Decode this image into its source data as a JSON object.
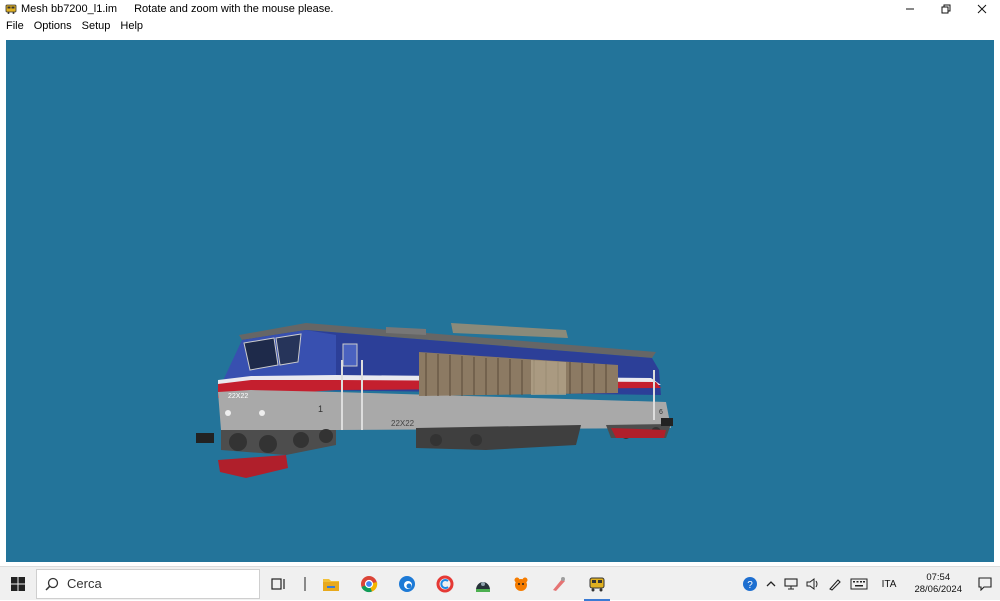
{
  "window": {
    "title": "Mesh bb7200_l1.im",
    "hint": "Rotate and zoom with the mouse please.",
    "controls": [
      "minimize",
      "restore",
      "close"
    ]
  },
  "menu": {
    "items": [
      "File",
      "Options",
      "Setup",
      "Help"
    ]
  },
  "viewport": {
    "background": "#23749a",
    "model_labels": {
      "number_front": "22X22",
      "cab_number": "1",
      "side_number": "22X22",
      "rear_number": "6"
    }
  },
  "taskbar": {
    "search_placeholder": "Cerca",
    "pinned": [
      "task-view-icon",
      "file-explorer-icon",
      "chrome-icon",
      "edge-icon",
      "ccleaner-icon",
      "app-dome-icon",
      "app-animal-icon",
      "app-tool-icon",
      "train-viewer-icon"
    ],
    "tray": {
      "language": "ITA",
      "time": "07:54",
      "date": "28/06/2024"
    }
  },
  "colors": {
    "loco_blue": "#2c3f98",
    "loco_grey": "#a9a9a9",
    "loco_red": "#c41f2e"
  }
}
